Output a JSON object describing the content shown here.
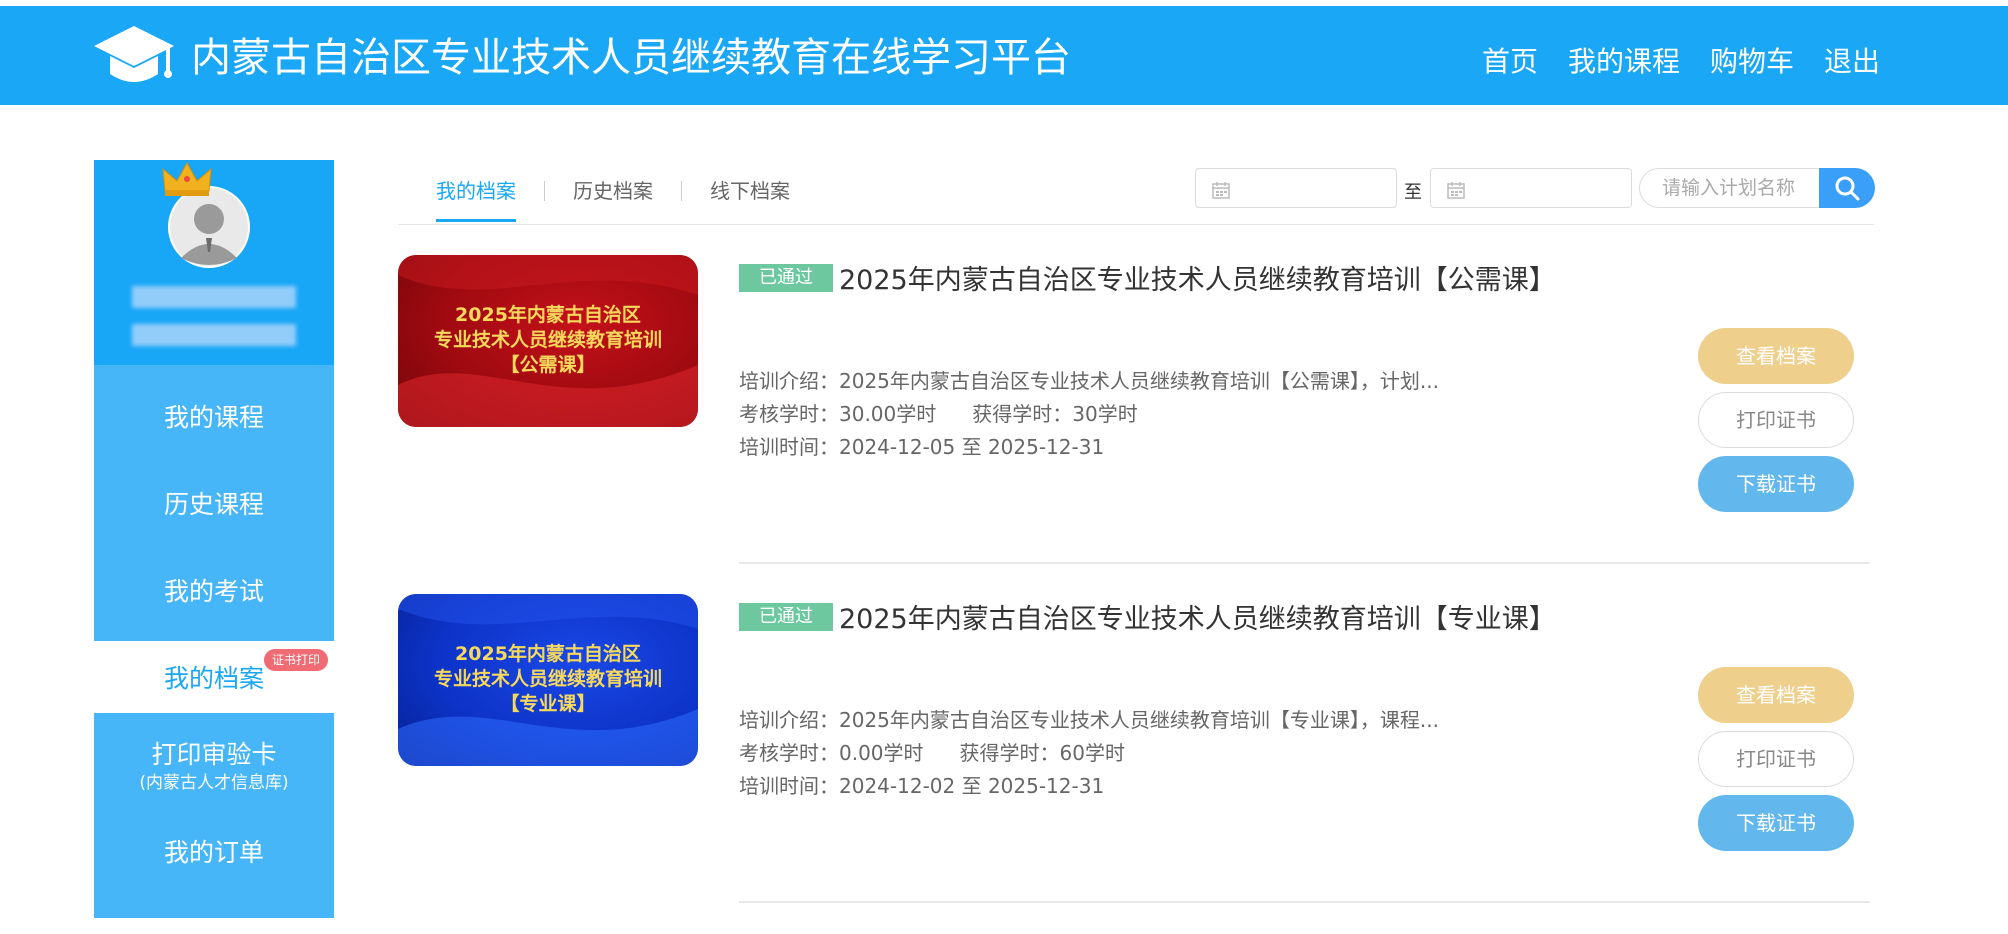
{
  "header": {
    "site_title": "内蒙古自治区专业技术人员继续教育在线学习平台",
    "nav": [
      "首页",
      "我的课程",
      "购物车",
      "退出"
    ]
  },
  "sidebar": {
    "items": [
      {
        "label": "我的课程"
      },
      {
        "label": "历史课程"
      },
      {
        "label": "我的考试"
      },
      {
        "label": "我的档案",
        "badge": "证书打印"
      },
      {
        "label": "打印审验卡",
        "sublabel": "(内蒙古人才信息库)"
      },
      {
        "label": "我的订单"
      }
    ]
  },
  "tabs": [
    "我的档案",
    "历史档案",
    "线下档案"
  ],
  "filters": {
    "date_to_label": "至",
    "search_placeholder": "请输入计划名称"
  },
  "courses": [
    {
      "thumb_lines": [
        "2025年内蒙古自治区",
        "专业技术人员继续教育培训",
        "【公需课】"
      ],
      "status": "已通过",
      "title": "2025年内蒙古自治区专业技术人员继续教育培训【公需课】",
      "intro": "培训介绍：2025年内蒙古自治区专业技术人员继续教育培训【公需课】，计划...",
      "required_hours": "考核学时：30.00学时",
      "earned_hours": "获得学时：30学时",
      "period": "培训时间：2024-12-05 至 2025-12-31",
      "buttons": [
        "查看档案",
        "打印证书",
        "下载证书"
      ]
    },
    {
      "thumb_lines": [
        "2025年内蒙古自治区",
        "专业技术人员继续教育培训",
        "【专业课】"
      ],
      "status": "已通过",
      "title": "2025年内蒙古自治区专业技术人员继续教育培训【专业课】",
      "intro": "培训介绍：2025年内蒙古自治区专业技术人员继续教育培训【专业课】，课程...",
      "required_hours": "考核学时：0.00学时",
      "earned_hours": "获得学时：60学时",
      "period": "培训时间：2024-12-02 至 2025-12-31",
      "buttons": [
        "查看档案",
        "打印证书",
        "下载证书"
      ]
    }
  ],
  "colors": {
    "brand_blue": "#19a7f6",
    "sidebar_blue": "#47b6f9",
    "passed_green": "#6dc8a0",
    "view_gold": "#efcf8c",
    "download_blue": "#62b8ec",
    "badge_red": "#f06b73"
  }
}
